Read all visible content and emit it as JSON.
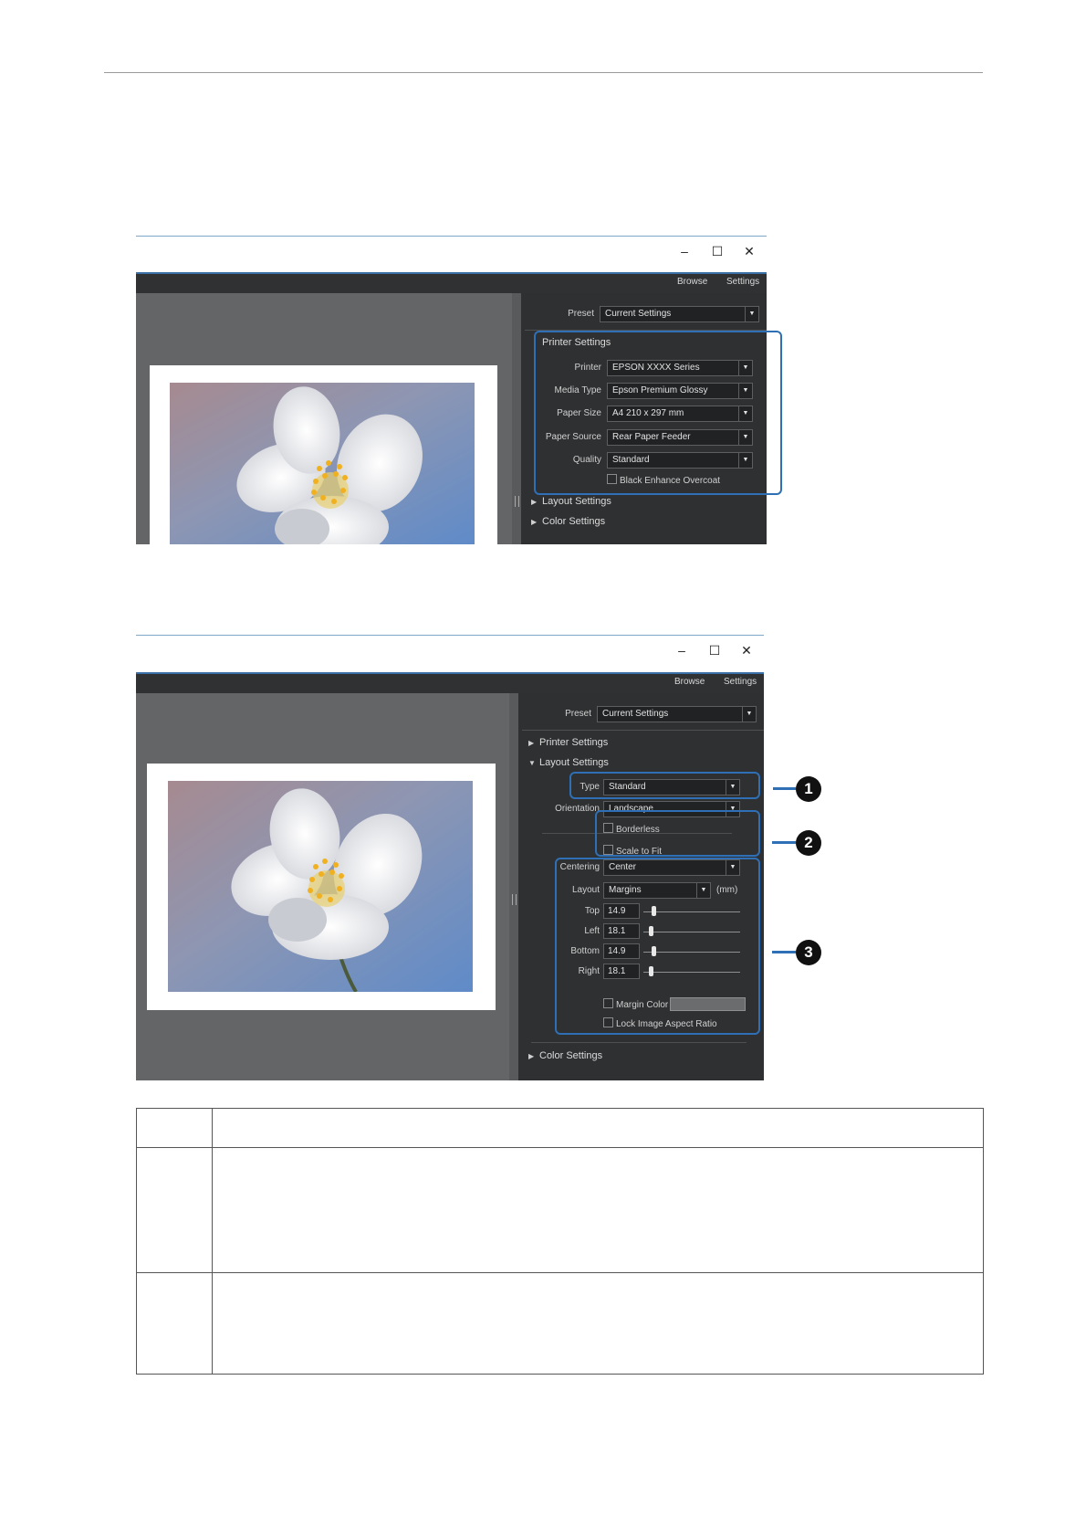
{
  "window_controls": {
    "minimize": "–",
    "maximize": "☐",
    "close": "✕"
  },
  "menubar": {
    "browse": "Browse",
    "settings": "Settings"
  },
  "screen1": {
    "preset": {
      "label": "Preset",
      "value": "Current Settings"
    },
    "printer_settings": {
      "title": "Printer Settings",
      "printer": {
        "label": "Printer",
        "value": "EPSON XXXX Series"
      },
      "media_type": {
        "label": "Media Type",
        "value": "Epson Premium Glossy"
      },
      "paper_size": {
        "label": "Paper Size",
        "value": "A4 210 x 297 mm"
      },
      "paper_source": {
        "label": "Paper Source",
        "value": "Rear Paper Feeder"
      },
      "quality": {
        "label": "Quality",
        "value": "Standard"
      },
      "black_enhance": "Black Enhance Overcoat"
    },
    "sections": {
      "layout": "Layout Settings",
      "color": "Color Settings"
    }
  },
  "screen2": {
    "preset": {
      "label": "Preset",
      "value": "Current Settings"
    },
    "sections": {
      "printer": "Printer Settings",
      "layout": "Layout Settings",
      "color": "Color Settings"
    },
    "type": {
      "label": "Type",
      "value": "Standard"
    },
    "orientation": {
      "label": "Orientation",
      "value": "Landscape"
    },
    "borderless": "Borderless",
    "scale_to_fit": "Scale to Fit",
    "centering": {
      "label": "Centering",
      "value": "Center"
    },
    "layout": {
      "label": "Layout",
      "value": "Margins",
      "unit": "(mm)"
    },
    "margins": [
      {
        "label": "Top",
        "value": "14.9",
        "level": 0.1
      },
      {
        "label": "Left",
        "value": "18.1",
        "level": 0.08
      },
      {
        "label": "Bottom",
        "value": "14.9",
        "level": 0.1
      },
      {
        "label": "Right",
        "value": "18.1",
        "level": 0.08
      }
    ],
    "margin_color": "Margin Color",
    "lock_aspect": "Lock Image Aspect Ratio",
    "callouts": [
      "1",
      "2",
      "3"
    ]
  },
  "colors": {
    "highlight": "#2f6fb5",
    "panel": "#2e3032",
    "preview": "#636567"
  }
}
